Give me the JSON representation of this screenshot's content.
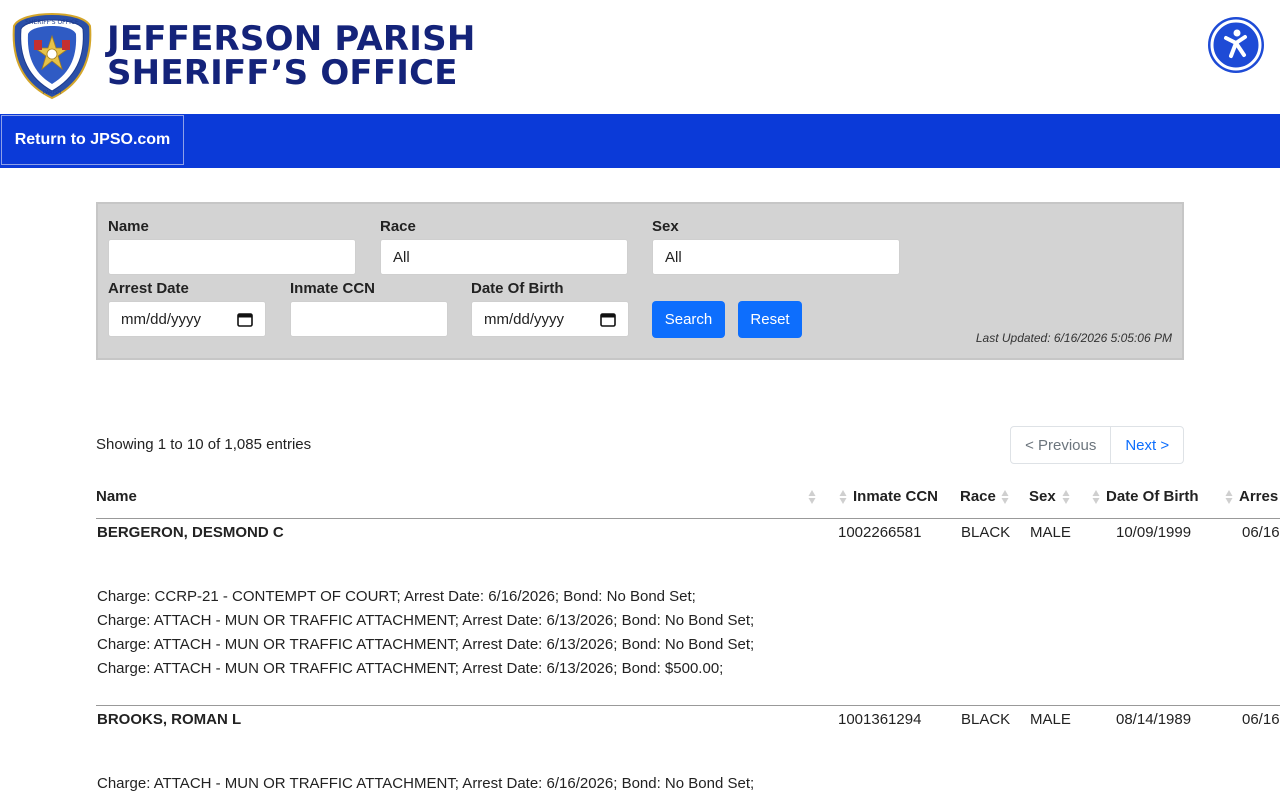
{
  "header": {
    "brand_line1": "JEFFERSON PARISH",
    "brand_line2": "SHERIFF’S OFFICE",
    "logo_text_top": "SHERIFF'S OFFICE",
    "logo_text_left": "JEFFERSON",
    "logo_text_right": "LOUISIANA",
    "logo_text_bottom": "PARISH"
  },
  "nav": {
    "return_label": "Return to JPSO.com"
  },
  "filters": {
    "name_label": "Name",
    "name_value": "",
    "race_label": "Race",
    "race_value": "All",
    "sex_label": "Sex",
    "sex_value": "All",
    "arrest_date_label": "Arrest Date",
    "arrest_date_placeholder": "mm/dd/yyyy",
    "ccn_label": "Inmate CCN",
    "ccn_value": "",
    "dob_label": "Date Of Birth",
    "dob_placeholder": "mm/dd/yyyy",
    "search_label": "Search",
    "reset_label": "Reset",
    "last_updated": "Last Updated: 6/16/2026 5:05:06 PM"
  },
  "table": {
    "showing": "Showing 1 to 10 of 1,085 entries",
    "prev_label": "< Previous",
    "next_label": "Next >",
    "columns": [
      "Name",
      "Inmate CCN",
      "Race",
      "Sex",
      "Date Of Birth",
      "Arres"
    ],
    "rows": [
      {
        "name": "BERGERON, DESMOND C",
        "ccn": "1002266581",
        "race": "BLACK",
        "sex": "MALE",
        "dob": "10/09/1999",
        "arrest": "06/16",
        "charges": [
          "Charge: CCRP-21 - CONTEMPT OF COURT; Arrest Date: 6/16/2026; Bond: No Bond Set;",
          "Charge: ATTACH - MUN OR TRAFFIC ATTACHMENT; Arrest Date: 6/13/2026; Bond: No Bond Set;",
          "Charge: ATTACH - MUN OR TRAFFIC ATTACHMENT; Arrest Date: 6/13/2026; Bond: No Bond Set;",
          "Charge: ATTACH - MUN OR TRAFFIC ATTACHMENT; Arrest Date: 6/13/2026; Bond: $500.00;"
        ]
      },
      {
        "name": "BROOKS, ROMAN L",
        "ccn": "1001361294",
        "race": "BLACK",
        "sex": "MALE",
        "dob": "08/14/1989",
        "arrest": "06/16",
        "charges": [
          "Charge: ATTACH - MUN OR TRAFFIC ATTACHMENT; Arrest Date: 6/16/2026; Bond: No Bond Set;"
        ]
      }
    ]
  },
  "colors": {
    "nav_blue": "#0b3ad8",
    "brand_navy": "#14237a",
    "button_blue": "#0d6efd",
    "panel_gray": "#d3d3d3"
  },
  "icons": {
    "logo": "sheriff-badge-icon",
    "accessibility": "accessibility-icon",
    "calendar": "calendar-icon",
    "sort": "sort-icon"
  }
}
